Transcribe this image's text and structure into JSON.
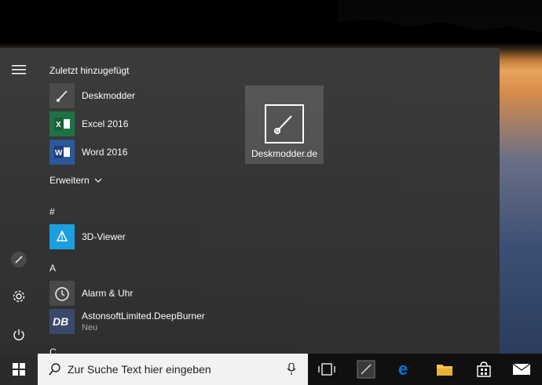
{
  "start_menu": {
    "recent_header": "Zuletzt hinzugefügt",
    "recent_items": [
      {
        "label": "Deskmodder"
      },
      {
        "label": "Excel 2016"
      },
      {
        "label": "Word 2016"
      }
    ],
    "expand_label": "Erweitern",
    "sections": [
      {
        "letter": "#",
        "items": [
          {
            "label": "3D-Viewer"
          }
        ]
      },
      {
        "letter": "A",
        "items": [
          {
            "label": "Alarm & Uhr"
          },
          {
            "label": "AstonsoftLimited.DeepBurner",
            "sublabel": "Neu"
          }
        ]
      },
      {
        "letter": "C"
      }
    ],
    "tile": {
      "label": "Deskmodder.de"
    }
  },
  "taskbar": {
    "search_placeholder": "Zur Suche Text hier eingeben"
  },
  "colors": {
    "excel": "#1e7145",
    "word": "#2b579a",
    "viewer3d": "#1ba1e2",
    "edge": "#0078d7",
    "accent": "#0078d7"
  }
}
